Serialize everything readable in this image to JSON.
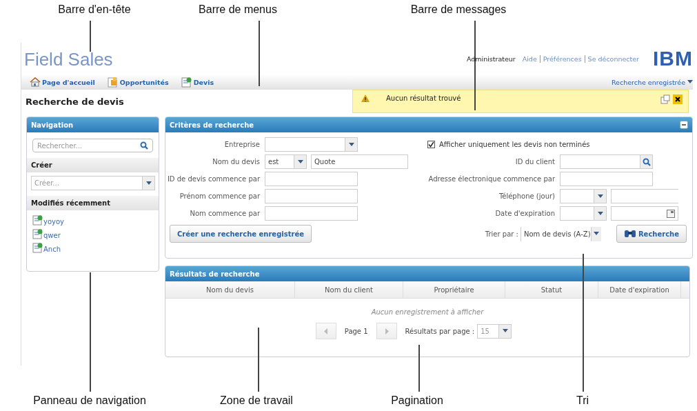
{
  "top_callouts": [
    "Barre d'en-tête",
    "Barre de menus",
    "Barre de messages"
  ],
  "bottom_callouts": [
    "Panneau de navigation",
    "Zone de travail",
    "Pagination",
    "Tri"
  ],
  "header": {
    "app_title": "Field Sales",
    "user": "Administrateur",
    "links": [
      "Aide",
      "Préférences",
      "Se déconnecter"
    ],
    "logo": "IBM"
  },
  "menu": {
    "items": [
      "Page d'accueil",
      "Opportunités",
      "Devis"
    ],
    "saved_search": "Recherche enregistrée"
  },
  "page_title": "Recherche de devis",
  "message": {
    "text": "Aucun résultat trouvé"
  },
  "navigation": {
    "title": "Navigation",
    "search": {
      "placeholder": "Rechercher..."
    },
    "create_heading": "Créer",
    "create_select": {
      "placeholder": "Créer..."
    },
    "recent_heading": "Modifiés récemment",
    "recent_items": [
      "yoyoy",
      "qwer",
      "Anch"
    ]
  },
  "criteria": {
    "title": "Critères de recherche",
    "left_fields": [
      {
        "label": "Entreprise",
        "kind": "select"
      },
      {
        "label": "Nom du devis",
        "kind": "operator",
        "operator": "est",
        "value": "Quote"
      },
      {
        "label": "ID de devis commence par",
        "kind": "text"
      },
      {
        "label": "Prénom commence par",
        "kind": "text"
      },
      {
        "label": "Nom commence par",
        "kind": "text"
      }
    ],
    "show_unfinished": {
      "label": "Afficher uniquement les devis non terminés",
      "checked": true
    },
    "right_fields": [
      {
        "label": "ID du client",
        "kind": "lookup"
      },
      {
        "label": "Adresse électronique commence par",
        "kind": "text"
      },
      {
        "label": "Téléphone (jour)",
        "kind": "select_text"
      },
      {
        "label": "Date d'expiration",
        "kind": "select_date"
      }
    ],
    "save_button": "Créer une recherche enregistrée",
    "sort": {
      "label": "Trier par :",
      "value": "Nom de devis (A-Z)"
    },
    "search_button": "Recherche"
  },
  "results": {
    "title": "Résultats de recherche",
    "columns": [
      "Nom du devis",
      "Nom du client",
      "Propriétaire",
      "Statut",
      "Date d'expiration"
    ],
    "empty_message": "Aucun enregistrement à afficher",
    "pagination": {
      "page": "Page 1",
      "per_page_label": "Résultats par page :",
      "per_page": "15"
    }
  }
}
